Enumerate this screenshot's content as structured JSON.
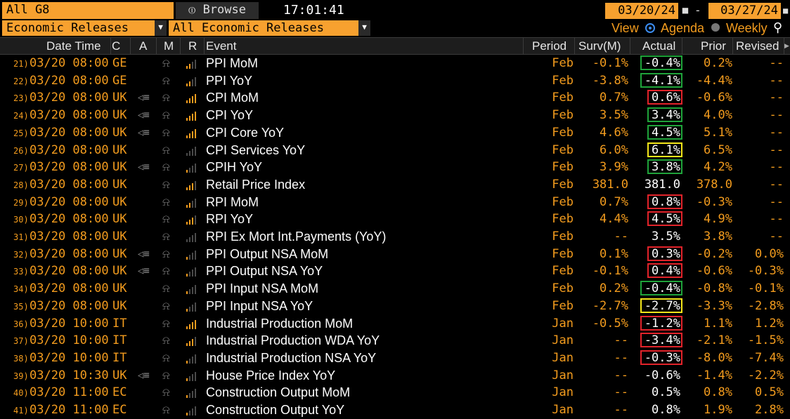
{
  "toolbar": {
    "group": "All G8",
    "browse": "Browse",
    "time": "17:01:41",
    "start_date": "03/20/24",
    "end_date": "03/27/24",
    "date_sep": "-",
    "category1": "Economic Releases",
    "category2": "All Economic Releases",
    "view_label": "View",
    "agenda_label": "Agenda",
    "weekly_label": "Weekly"
  },
  "columns": {
    "datetime": "Date Time",
    "c": "C",
    "a": "A",
    "m": "M",
    "r": "R",
    "event": "Event",
    "period": "Period",
    "surv": "Surv(M)",
    "actual": "Actual",
    "prior": "Prior",
    "revised": "Revised"
  },
  "colors": {
    "orange": "#f39c1e",
    "green_box": "#1fa33a",
    "red_box": "#e2232a",
    "yellow_box": "#f4e61a"
  },
  "rows": [
    {
      "n": "21)",
      "date": "03/20 08:00",
      "c": "GE",
      "a": false,
      "bars": 2,
      "event": "PPI MoM",
      "period": "Feb",
      "surv": "-0.1%",
      "actual": "-0.4%",
      "prior": "0.2%",
      "revised": "--",
      "box": "green"
    },
    {
      "n": "22)",
      "date": "03/20 08:00",
      "c": "GE",
      "a": false,
      "bars": 2,
      "event": "PPI YoY",
      "period": "Feb",
      "surv": "-3.8%",
      "actual": "-4.1%",
      "prior": "-4.4%",
      "revised": "--",
      "box": "green"
    },
    {
      "n": "23)",
      "date": "03/20 08:00",
      "c": "UK",
      "a": true,
      "bars": 4,
      "event": "CPI MoM",
      "period": "Feb",
      "surv": "0.7%",
      "actual": "0.6%",
      "prior": "-0.6%",
      "revised": "--",
      "box": "red"
    },
    {
      "n": "24)",
      "date": "03/20 08:00",
      "c": "UK",
      "a": true,
      "bars": 4,
      "event": "CPI YoY",
      "period": "Feb",
      "surv": "3.5%",
      "actual": "3.4%",
      "prior": "4.0%",
      "revised": "--",
      "box": "green"
    },
    {
      "n": "25)",
      "date": "03/20 08:00",
      "c": "UK",
      "a": true,
      "bars": 4,
      "event": "CPI Core YoY",
      "period": "Feb",
      "surv": "4.6%",
      "actual": "4.5%",
      "prior": "5.1%",
      "revised": "--",
      "box": "green"
    },
    {
      "n": "26)",
      "date": "03/20 08:00",
      "c": "UK",
      "a": false,
      "bars": 0,
      "event": "CPI Services YoY",
      "period": "Feb",
      "surv": "6.0%",
      "actual": "6.1%",
      "prior": "6.5%",
      "revised": "--",
      "box": "yellow"
    },
    {
      "n": "27)",
      "date": "03/20 08:00",
      "c": "UK",
      "a": true,
      "bars": 1,
      "event": "CPIH YoY",
      "period": "Feb",
      "surv": "3.9%",
      "actual": "3.8%",
      "prior": "4.2%",
      "revised": "--",
      "box": "green"
    },
    {
      "n": "28)",
      "date": "03/20 08:00",
      "c": "UK",
      "a": false,
      "bars": 3,
      "event": "Retail Price Index",
      "period": "Feb",
      "surv": "381.0",
      "actual": "381.0",
      "prior": "378.0",
      "revised": "--",
      "box": ""
    },
    {
      "n": "29)",
      "date": "03/20 08:00",
      "c": "UK",
      "a": false,
      "bars": 2,
      "event": "RPI MoM",
      "period": "Feb",
      "surv": "0.7%",
      "actual": "0.8%",
      "prior": "-0.3%",
      "revised": "--",
      "box": "red"
    },
    {
      "n": "30)",
      "date": "03/20 08:00",
      "c": "UK",
      "a": false,
      "bars": 3,
      "event": "RPI YoY",
      "period": "Feb",
      "surv": "4.4%",
      "actual": "4.5%",
      "prior": "4.9%",
      "revised": "--",
      "box": "red"
    },
    {
      "n": "31)",
      "date": "03/20 08:00",
      "c": "UK",
      "a": false,
      "bars": 0,
      "event": "RPI Ex Mort Int.Payments (YoY)",
      "period": "Feb",
      "surv": "--",
      "actual": "3.5%",
      "prior": "3.8%",
      "revised": "--",
      "box": ""
    },
    {
      "n": "32)",
      "date": "03/20 08:00",
      "c": "UK",
      "a": true,
      "bars": 1,
      "event": "PPI Output NSA MoM",
      "period": "Feb",
      "surv": "0.1%",
      "actual": "0.3%",
      "prior": "-0.2%",
      "revised": "0.0%",
      "box": "red"
    },
    {
      "n": "33)",
      "date": "03/20 08:00",
      "c": "UK",
      "a": true,
      "bars": 1,
      "event": "PPI Output NSA YoY",
      "period": "Feb",
      "surv": "-0.1%",
      "actual": "0.4%",
      "prior": "-0.6%",
      "revised": "-0.3%",
      "box": "red"
    },
    {
      "n": "34)",
      "date": "03/20 08:00",
      "c": "UK",
      "a": false,
      "bars": 1,
      "event": "PPI Input NSA MoM",
      "period": "Feb",
      "surv": "0.2%",
      "actual": "-0.4%",
      "prior": "-0.8%",
      "revised": "-0.1%",
      "box": "green"
    },
    {
      "n": "35)",
      "date": "03/20 08:00",
      "c": "UK",
      "a": false,
      "bars": 1,
      "event": "PPI Input NSA YoY",
      "period": "Feb",
      "surv": "-2.7%",
      "actual": "-2.7%",
      "prior": "-3.3%",
      "revised": "-2.8%",
      "box": "yellow"
    },
    {
      "n": "36)",
      "date": "03/20 10:00",
      "c": "IT",
      "a": false,
      "bars": 4,
      "event": "Industrial Production MoM",
      "period": "Jan",
      "surv": "-0.5%",
      "actual": "-1.2%",
      "prior": "1.1%",
      "revised": "1.2%",
      "box": "red"
    },
    {
      "n": "37)",
      "date": "03/20 10:00",
      "c": "IT",
      "a": false,
      "bars": 3,
      "event": "Industrial Production WDA YoY",
      "period": "Jan",
      "surv": "--",
      "actual": "-3.4%",
      "prior": "-2.1%",
      "revised": "-1.5%",
      "box": "red"
    },
    {
      "n": "38)",
      "date": "03/20 10:00",
      "c": "IT",
      "a": false,
      "bars": 1,
      "event": "Industrial Production NSA YoY",
      "period": "Jan",
      "surv": "--",
      "actual": "-0.3%",
      "prior": "-8.0%",
      "revised": "-7.4%",
      "box": "red"
    },
    {
      "n": "39)",
      "date": "03/20 10:30",
      "c": "UK",
      "a": true,
      "bars": 1,
      "event": "House Price Index YoY",
      "period": "Jan",
      "surv": "--",
      "actual": "-0.6%",
      "prior": "-1.4%",
      "revised": "-2.2%",
      "box": ""
    },
    {
      "n": "40)",
      "date": "03/20 11:00",
      "c": "EC",
      "a": false,
      "bars": 1,
      "event": "Construction Output MoM",
      "period": "Jan",
      "surv": "--",
      "actual": "0.5%",
      "prior": "0.8%",
      "revised": "0.5%",
      "box": ""
    },
    {
      "n": "41)",
      "date": "03/20 11:00",
      "c": "EC",
      "a": false,
      "bars": 1,
      "event": "Construction Output YoY",
      "period": "Jan",
      "surv": "--",
      "actual": "0.8%",
      "prior": "1.9%",
      "revised": "2.8%",
      "box": ""
    }
  ]
}
